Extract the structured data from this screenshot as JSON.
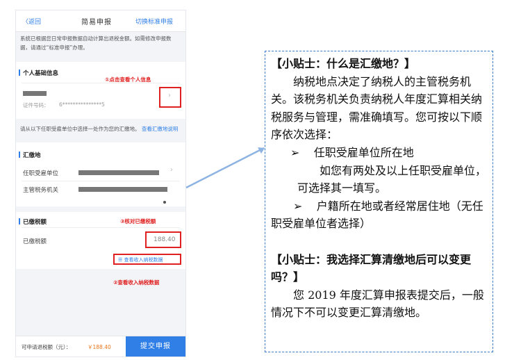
{
  "phone": {
    "back_label": "〈返回",
    "title": "简易申报",
    "switch_link": "切换标准申报",
    "notice": "系统已根据您日常申报数据自动计算出退税金额。如需修改申报数据，请通过“标准申报”办理。",
    "personal_section": "个人基础信息",
    "personal_note": "①点击查看个人信息",
    "id_label": "证件号码：",
    "id_value": "6***************5",
    "select_hint": "请从以下任职受雇单位中选择一处作为您的汇缴地。",
    "select_hint_link": "查看汇缴地说明",
    "remit_section": "汇缴地",
    "employer_label": "任职受雇单位",
    "tax_office_label": "主管税务机关",
    "paid_section": "已缴税额",
    "paid_note": "③核对已缴税额",
    "paid_label": "已缴税额",
    "paid_value": "188.40",
    "income_link": "☰ 查看收入纳税数据",
    "income_note": "②查看收入纳税数据",
    "refund_label": "可申请退税额（元）：",
    "refund_value": "￥188.40",
    "submit_label": "提交申报"
  },
  "tips": {
    "tip1_title": "【小贴士：什么是汇缴地？】",
    "tip1_body": "纳税地点决定了纳税人的主管税务机关。该税务机关负责纳税人年度汇算相关纳税服务与管理，需准确填写。您可按以下顺序依次选择：",
    "bullet_mark": "➢",
    "option1": "任职受雇单位所在地",
    "option1_note": "如您有两处及以上任职受雇单位，可选择其一填写。",
    "option2": "户籍所在地或者经常居住地（无任职受雇单位者选择）",
    "tip2_title": "【小贴士：我选择汇算清缴地后可以变更吗？】",
    "tip2_body": "您 2019 年度汇算申报表提交后，一般情况下不可以变更汇算清缴地。"
  }
}
